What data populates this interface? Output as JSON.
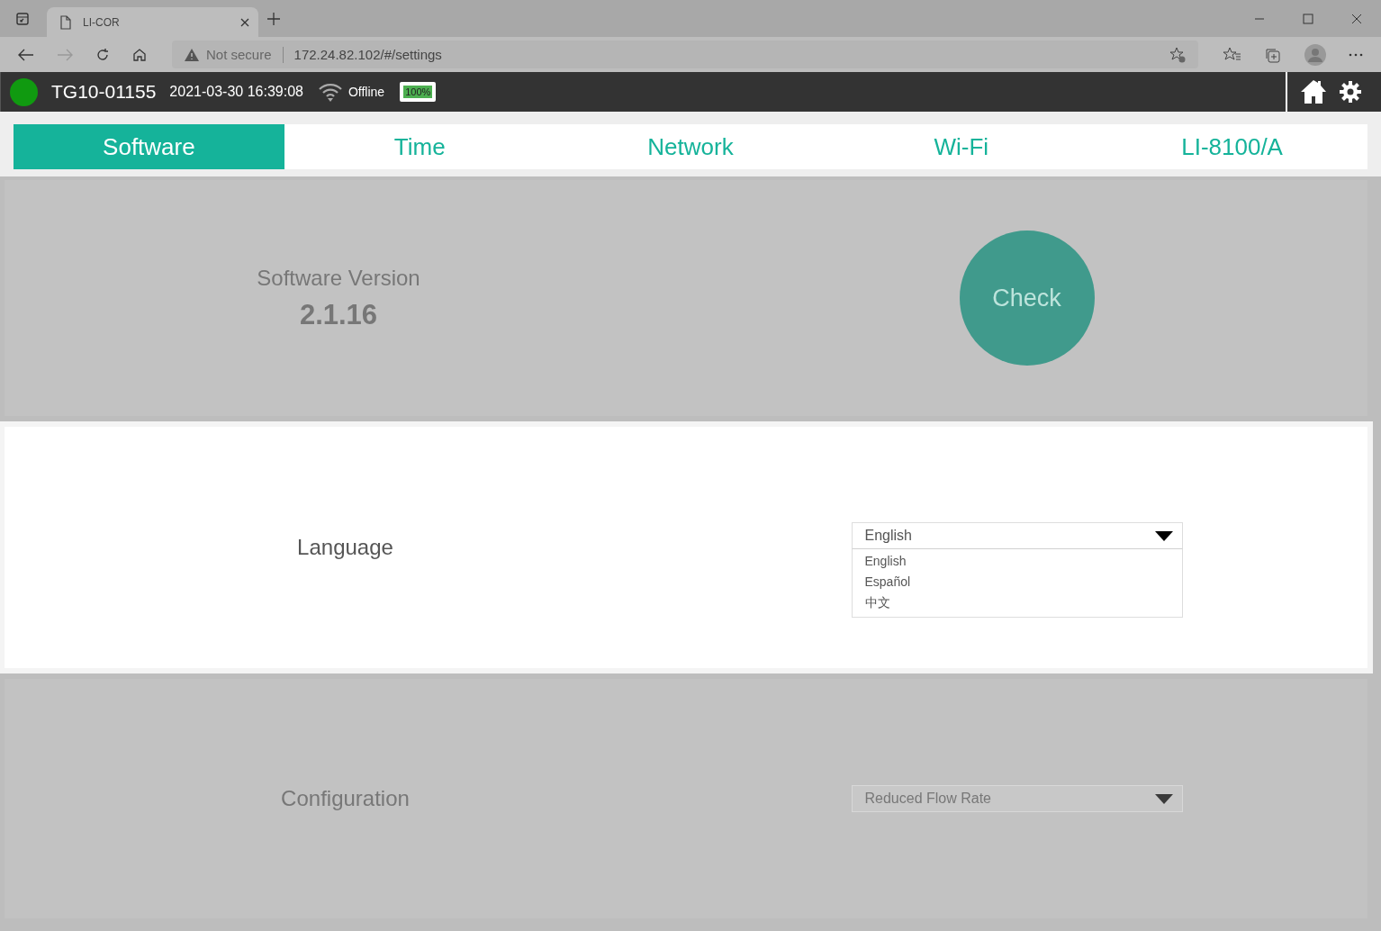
{
  "browser": {
    "tab_title": "LI-COR",
    "security": "Not secure",
    "url": "172.24.82.102/#/settings"
  },
  "header": {
    "device": "TG10-01155",
    "datetime": "2021-03-30 16:39:08",
    "network": "Offline",
    "battery": "100%"
  },
  "tabs": [
    {
      "label": "Software",
      "selected": true
    },
    {
      "label": "Time",
      "selected": false
    },
    {
      "label": "Network",
      "selected": false
    },
    {
      "label": "Wi-Fi",
      "selected": false
    },
    {
      "label": "LI-8100/A",
      "selected": false
    }
  ],
  "panels": [
    {
      "kind": "version",
      "dimmed": true,
      "label": "Software Version",
      "version": "2.1.16",
      "button": "Check"
    },
    {
      "kind": "select",
      "dimmed": false,
      "label": "Language",
      "value": "English",
      "expanded": true,
      "options": [
        "English",
        "Español",
        "中文"
      ]
    },
    {
      "kind": "select",
      "dimmed": true,
      "label": "Configuration",
      "value": "Reduced Flow Rate",
      "expanded": false
    }
  ]
}
